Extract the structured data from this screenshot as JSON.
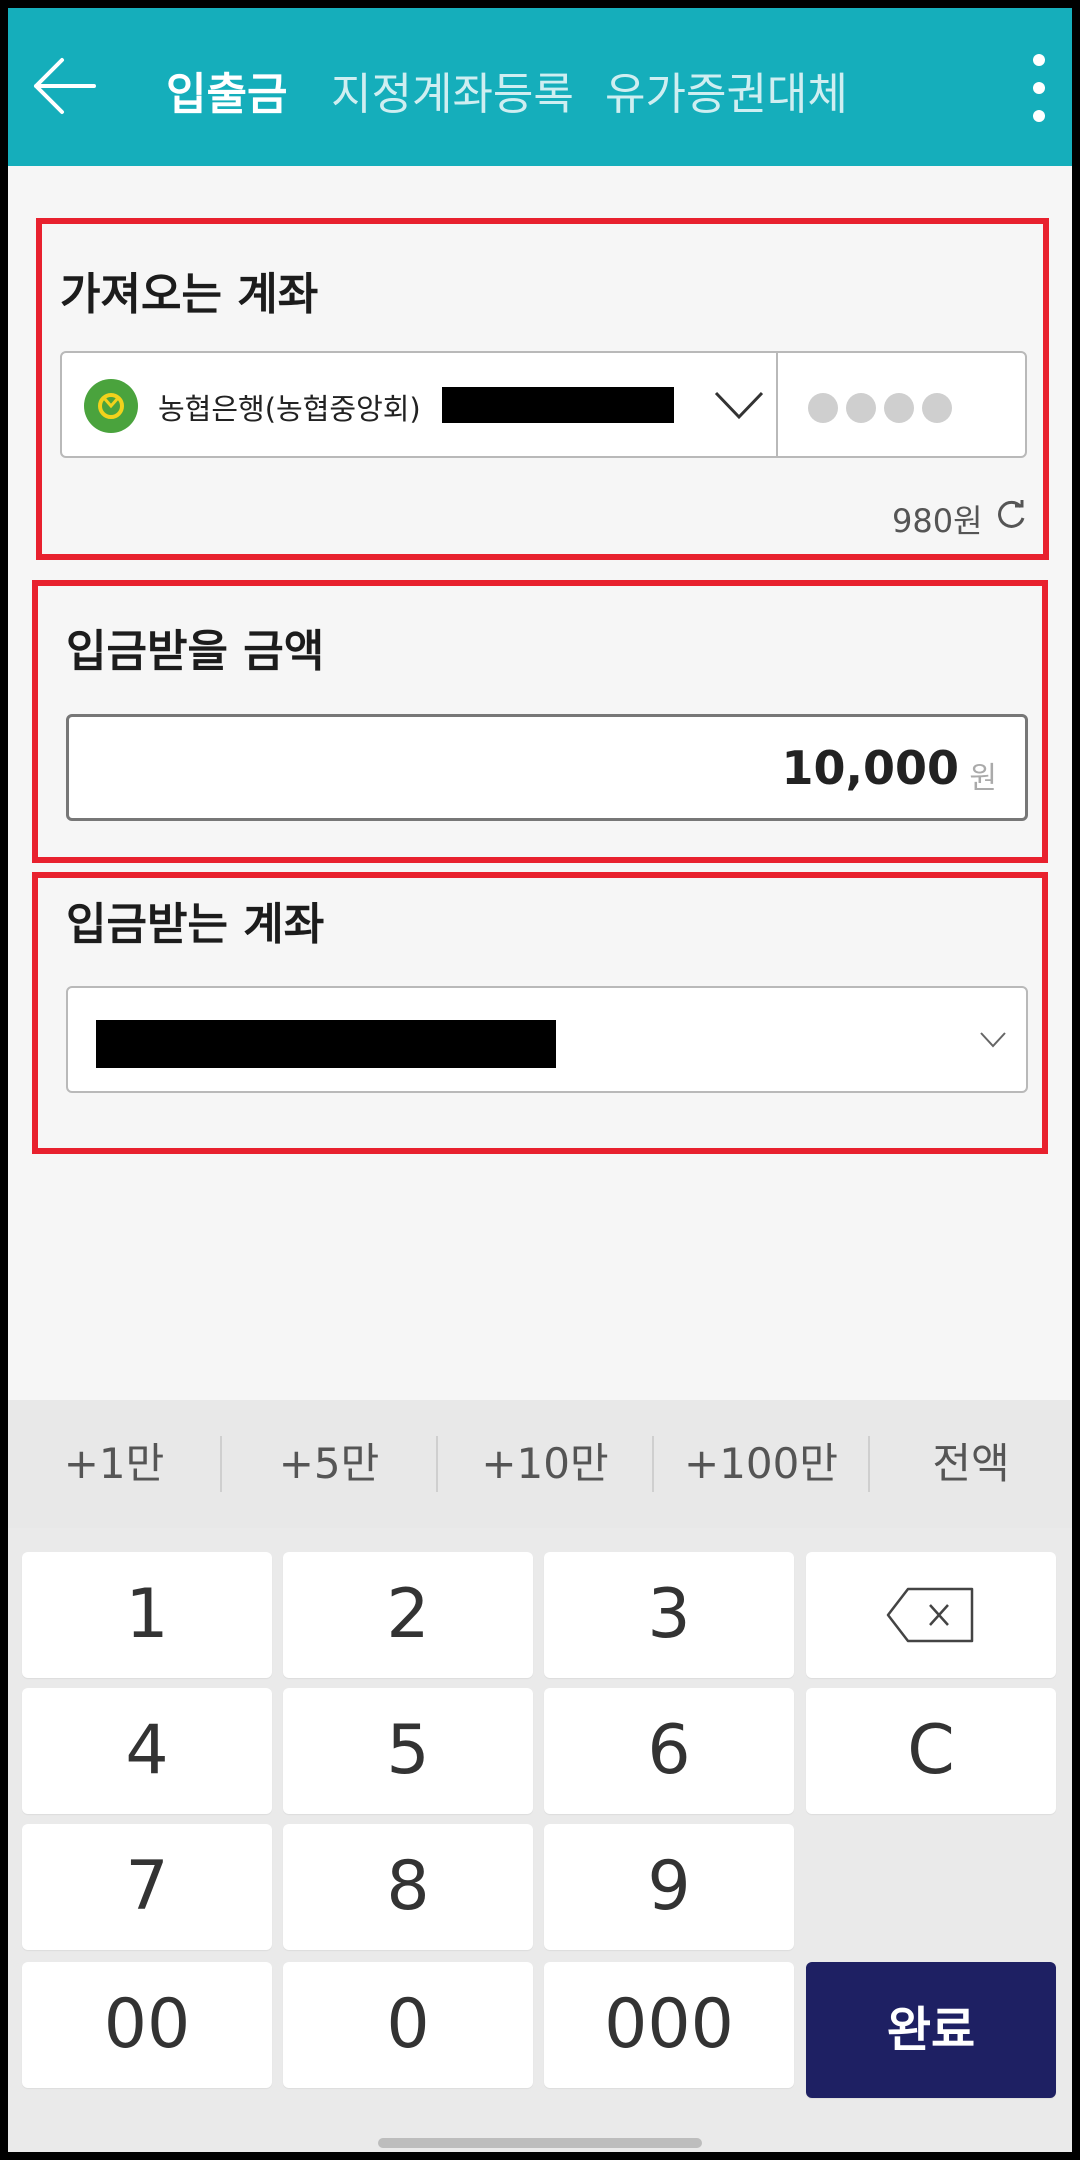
{
  "header": {
    "tabs": [
      {
        "label": "입출금",
        "active": true
      },
      {
        "label": "지정계좌등록",
        "active": false
      },
      {
        "label": "유가증권대체",
        "active": false
      }
    ],
    "back_icon": "arrow-left-icon",
    "more_icon": "more-vertical-icon"
  },
  "from_account": {
    "title": "가져오는 계좌",
    "bank_name": "농협은행(농협중앙회)",
    "balance": "980원"
  },
  "amount": {
    "title": "입금받을 금액",
    "value": "10,000",
    "unit": "원"
  },
  "to_account": {
    "title": "입금받는 계좌"
  },
  "quick_amounts": [
    "+1만",
    "+5만",
    "+10만",
    "+100만",
    "전액"
  ],
  "keypad": {
    "keys": [
      "1",
      "2",
      "3",
      "4",
      "5",
      "6",
      "C",
      "7",
      "8",
      "9",
      "00",
      "0",
      "000"
    ],
    "done_label": "완료"
  },
  "colors": {
    "header": "#15aebb",
    "highlight_border": "#e8212e",
    "done_button": "#1e2063",
    "bank_logo": "#4aa33d"
  }
}
